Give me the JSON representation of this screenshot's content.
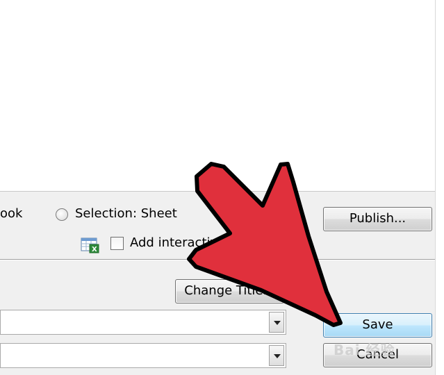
{
  "options": {
    "workbook_partial": "ook",
    "selection_label": "Selection: Sheet",
    "add_interactivity_partial": "Add interactivi"
  },
  "buttons": {
    "publish": "Publish...",
    "change_title": "Change Title...",
    "save": "Save",
    "cancel": "Cancel"
  },
  "fields": {
    "title_combo_value": "",
    "save_as_type_value": ""
  },
  "overlay": {
    "arrow_color": "#e0303c",
    "watermark": "Bai 经验"
  }
}
